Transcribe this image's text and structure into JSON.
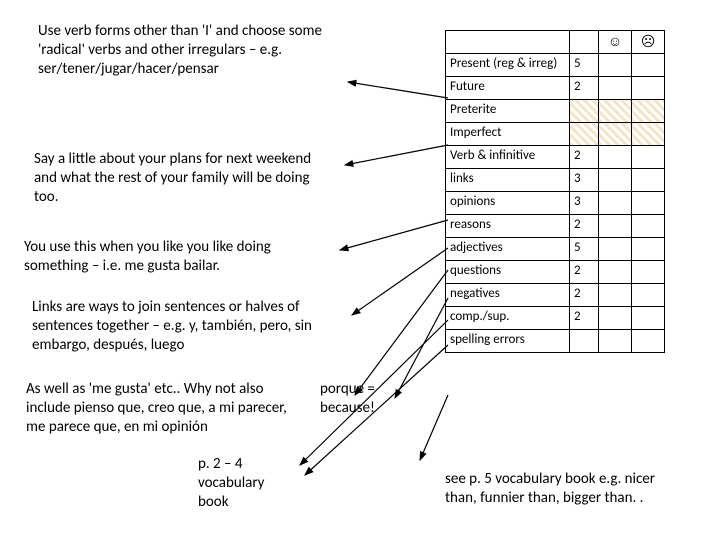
{
  "faces": {
    "smile": "☺",
    "frown": "☹"
  },
  "notes": {
    "n1": "Use verb forms other than 'I' and choose some 'radical' verbs and other irregulars – e.g. ser/tener/jugar/hacer/pensar",
    "n2": "Say a little about your plans for next weekend and what the rest of your family will be doing too.",
    "n3": "You use this when you like you like doing something – i.e. me gusta bailar.",
    "n4": "Links are ways to join sentences or halves of sentences together – e.g. y, también, pero, sin embargo, después, luego",
    "n5": "As well as 'me gusta' etc.. Why not also include pienso que, creo que, a mi parecer, me parece que, en mi opinión",
    "porque": "porque = because!",
    "vocab": "p. 2 – 4 vocabulary book",
    "footer": "see p. 5 vocabulary book e.g. nicer than, funnier than, bigger than. ."
  },
  "rows": [
    {
      "label": "Present (reg & irreg)",
      "val": "5",
      "hatch": false
    },
    {
      "label": "Future",
      "val": "2",
      "hatch": false
    },
    {
      "label": "Preterite",
      "val": "",
      "hatch": true
    },
    {
      "label": "Imperfect",
      "val": "",
      "hatch": true
    },
    {
      "label": "Verb & infinitive",
      "val": "2",
      "hatch": false
    },
    {
      "label": "links",
      "val": "3",
      "hatch": false
    },
    {
      "label": "opinions",
      "val": "3",
      "hatch": false
    },
    {
      "label": "reasons",
      "val": "2",
      "hatch": false
    },
    {
      "label": "adjectives",
      "val": "5",
      "hatch": false
    },
    {
      "label": "questions",
      "val": "2",
      "hatch": false
    },
    {
      "label": "negatives",
      "val": "2",
      "hatch": false
    },
    {
      "label": "comp./sup.",
      "val": "2",
      "hatch": false
    },
    {
      "label": "spelling errors",
      "val": "",
      "hatch": false
    }
  ]
}
